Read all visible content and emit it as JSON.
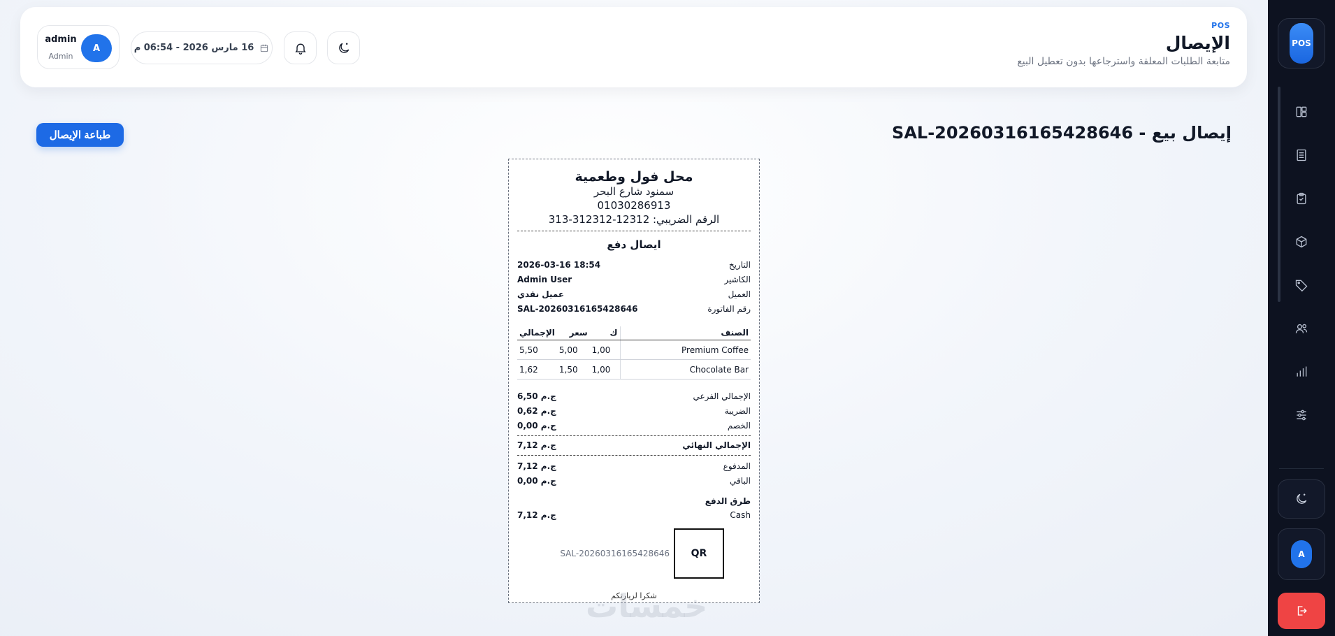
{
  "sidebar": {
    "logo": "POS",
    "nav": [
      {
        "name": "dashboard-icon"
      },
      {
        "name": "receipt-icon"
      },
      {
        "name": "orders-icon"
      },
      {
        "name": "products-icon"
      },
      {
        "name": "tags-icon"
      },
      {
        "name": "customers-icon"
      },
      {
        "name": "reports-icon"
      },
      {
        "name": "settings-icon"
      }
    ],
    "user_initial": "A"
  },
  "header": {
    "kicker": "POS",
    "title": "الإيصال",
    "subtitle": "متابعة الطلبات المعلقة واسترجاعها بدون تعطيل البيع",
    "user": {
      "initial": "A",
      "name": "admin",
      "role": "Admin"
    },
    "datetime": "16 مارس 2026 - 06:54 م"
  },
  "page": {
    "heading": "إيصال بيع - SAL-20260316165428646",
    "print_label": "طباعة الإيصال"
  },
  "receipt": {
    "store": "محل فول وطعمية",
    "address": "سمنود شارع البحر",
    "phone": "01030286913",
    "tax": "الرقم الضريبي: 12312-312312-313",
    "doc_title": "ايصال دفع",
    "info": [
      {
        "label": "التاريخ",
        "value": "2026-03-16 18:54"
      },
      {
        "label": "الكاشير",
        "value": "Admin User"
      },
      {
        "label": "العميل",
        "value": "عميل نقدي"
      },
      {
        "label": "رقم الفاتورة",
        "value": "SAL-20260316165428646"
      }
    ],
    "columns": {
      "item": "الصنف",
      "qty": "ك",
      "price": "سعر",
      "total": "الإجمالي"
    },
    "items": [
      {
        "name": "Premium Coffee",
        "qty": "1,00",
        "price": "5,00",
        "total": "5,50"
      },
      {
        "name": "Chocolate Bar",
        "qty": "1,00",
        "price": "1,50",
        "total": "1,62"
      }
    ],
    "subtotal": {
      "label": "الإجمالي الفرعي",
      "value": "ج.م 6,50"
    },
    "tax_amount": {
      "label": "الضريبة",
      "value": "ج.م 0,62"
    },
    "discount": {
      "label": "الخصم",
      "value": "ج.م 0,00"
    },
    "grand": {
      "label": "الإجمالي النهائي",
      "value": "ج.م 7,12"
    },
    "paid": {
      "label": "المدفوع",
      "value": "ج.م 7,12"
    },
    "change": {
      "label": "الباقي",
      "value": "ج.م 0,00"
    },
    "payment_title": "طرق الدفع",
    "payment": {
      "label": "Cash",
      "value": "ج.م 7,12"
    },
    "qr_label": "QR",
    "qr_ref": "SAL-20260316165428646",
    "thanks": "شكرا لزيارتكم"
  },
  "watermark": "خمسات"
}
